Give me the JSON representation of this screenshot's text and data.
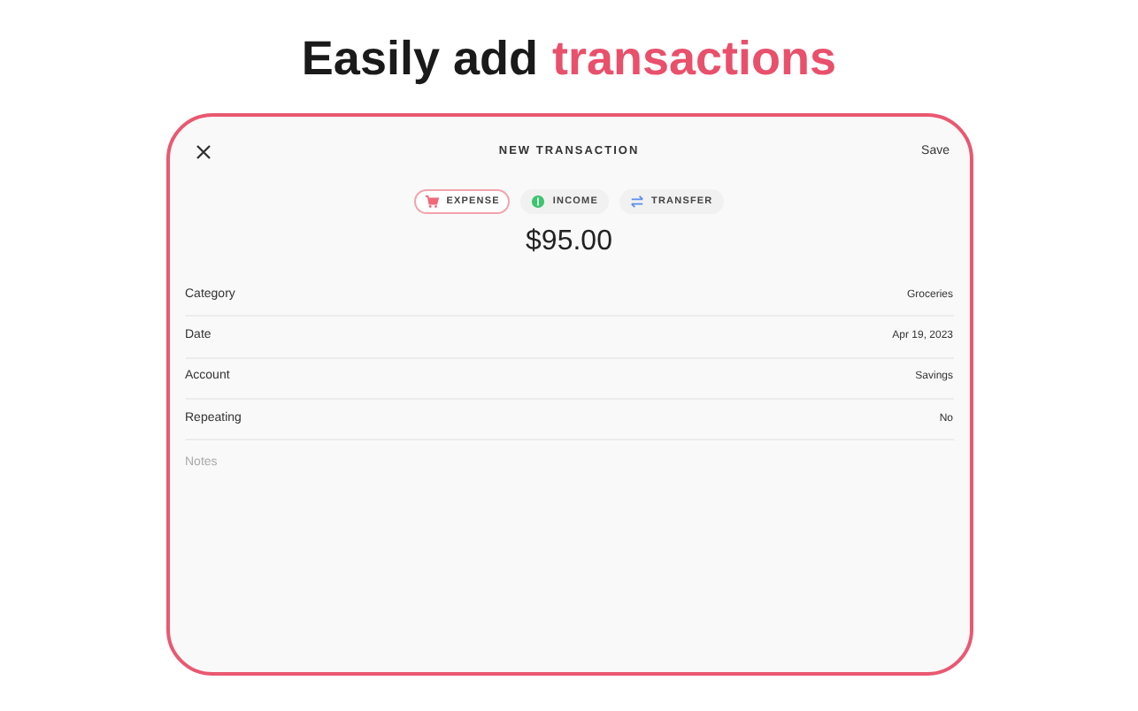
{
  "headline": {
    "text": "Easily add",
    "accent": "transactions"
  },
  "header": {
    "title": "NEW TRANSACTION",
    "action": "Save"
  },
  "types": [
    {
      "kind": "expense",
      "label": "EXPENSE",
      "selected": true
    },
    {
      "kind": "income",
      "label": "INCOME",
      "selected": false
    },
    {
      "kind": "transfer",
      "label": "TRANSFER",
      "selected": false
    }
  ],
  "amount": "$95.00",
  "fields": [
    {
      "label": "Category",
      "value": "Groceries"
    },
    {
      "label": "Date",
      "value": "Apr 19, 2023"
    },
    {
      "label": "Account",
      "value": "Savings"
    },
    {
      "label": "Repeating",
      "value": "No"
    }
  ],
  "notes": {
    "placeholder": "Notes"
  }
}
